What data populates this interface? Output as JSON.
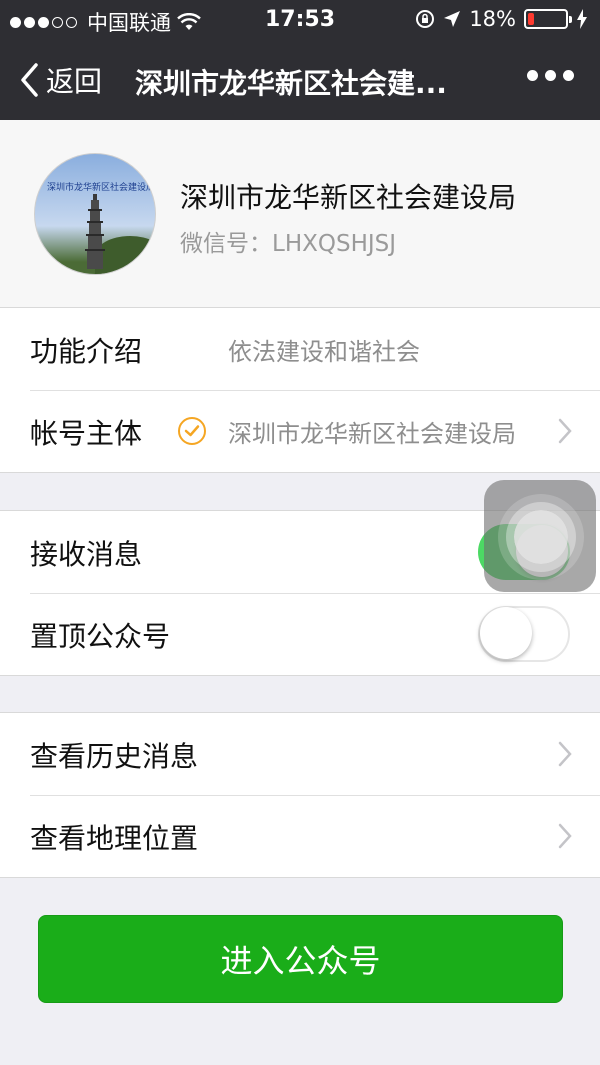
{
  "status_bar": {
    "carrier": "中国联通",
    "time": "17:53",
    "battery_percent": "18%",
    "battery_level": 0.18,
    "signal_bars_filled": 3,
    "icons": [
      "signal-dots-icon",
      "wifi-icon",
      "rotation-lock-icon",
      "location-arrow-icon",
      "battery-icon",
      "charging-bolt-icon"
    ]
  },
  "nav": {
    "back_label": "返回",
    "title": "深圳市龙华新区社会建...",
    "icons": [
      "back-chevron-icon",
      "more-dots-icon"
    ]
  },
  "profile": {
    "avatar_caption": "深圳市龙华新区社会建设局",
    "name": "深圳市龙华新区社会建设局",
    "wechat_id": "微信号：LHXQSHJSJ"
  },
  "info": [
    {
      "label": "功能介绍",
      "value": "依法建设和谐社会"
    },
    {
      "label": "帐号主体",
      "value": "深圳市龙华新区社会建设局",
      "verified": true
    }
  ],
  "settings": [
    {
      "label": "接收消息",
      "enabled": true
    },
    {
      "label": "置顶公众号",
      "enabled": false
    }
  ],
  "links": [
    {
      "label": "查看历史消息"
    },
    {
      "label": "查看地理位置"
    }
  ],
  "enter_button": "进入公众号",
  "colors": {
    "nav_bg": "#2e2e33",
    "switch_on": "#4cd964",
    "primary_button": "#1aad19",
    "verify_badge": "#f5a623",
    "battery_low": "#ff3b30"
  }
}
